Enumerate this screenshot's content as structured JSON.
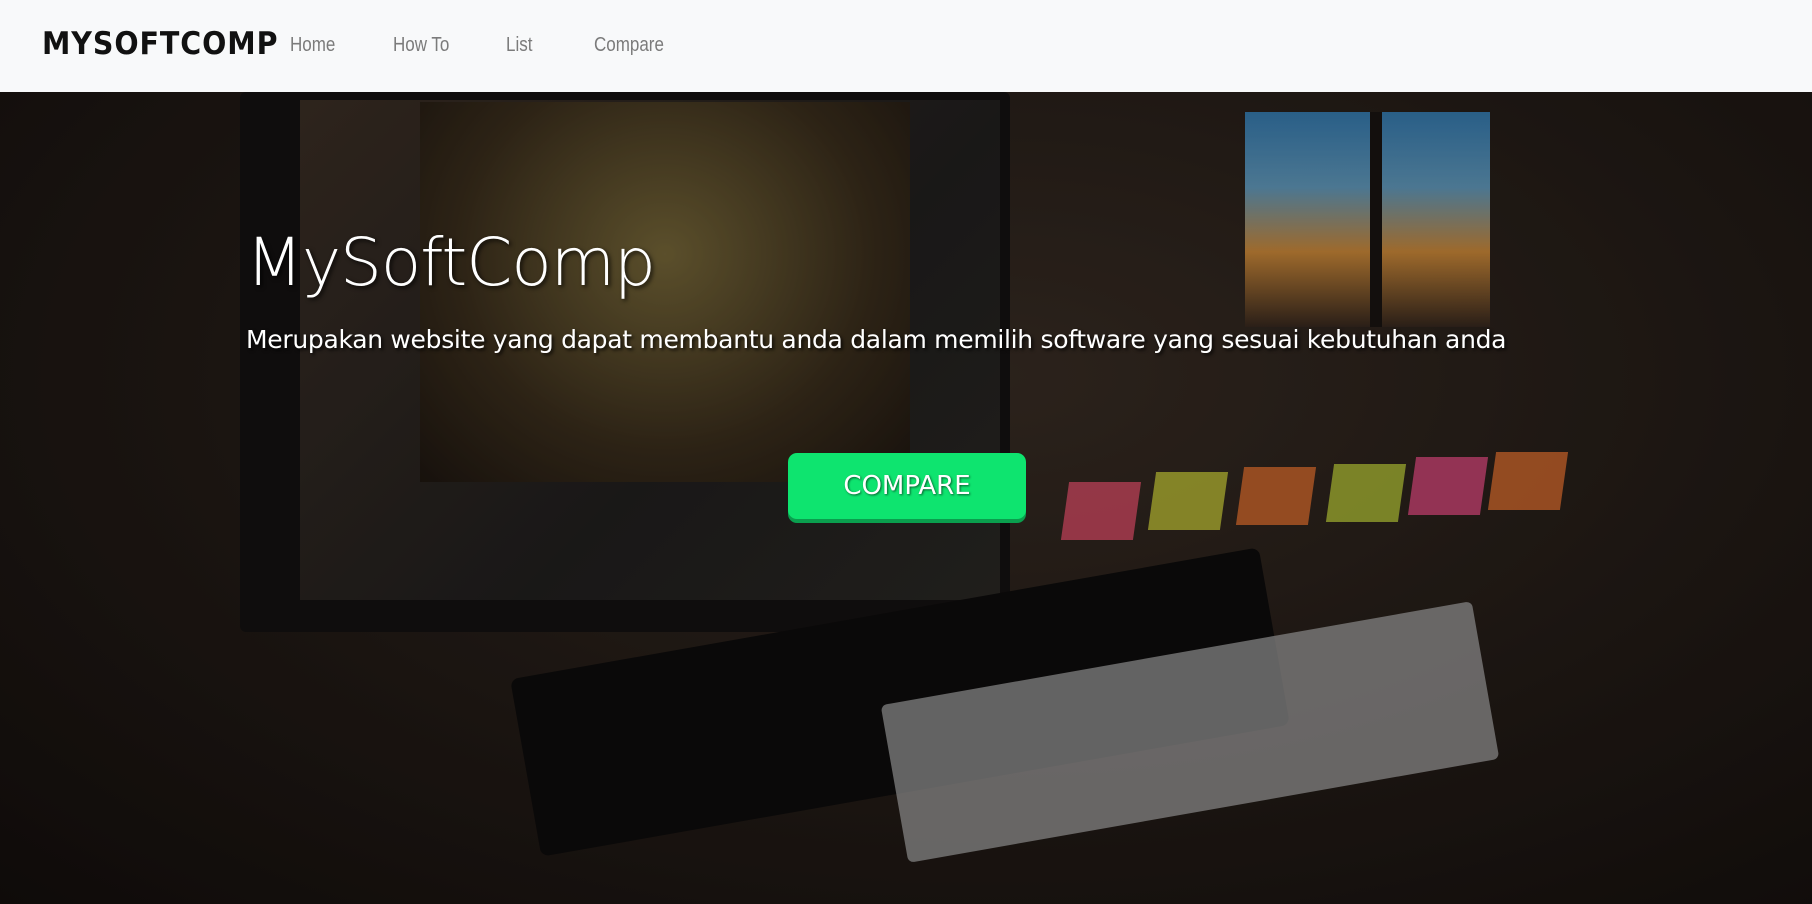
{
  "nav": {
    "logo": "MYSOFTCOMP",
    "items": [
      "Home",
      "How To",
      "List",
      "Compare"
    ]
  },
  "hero": {
    "title": "MySoftComp",
    "subtitle": "Merupakan website yang dapat membantu anda dalam memilih software yang sesuai kebutuhan anda",
    "button": "COMPARE"
  },
  "colors": {
    "accent": "#0ee46f",
    "nav_bg": "#f8f9fa"
  }
}
